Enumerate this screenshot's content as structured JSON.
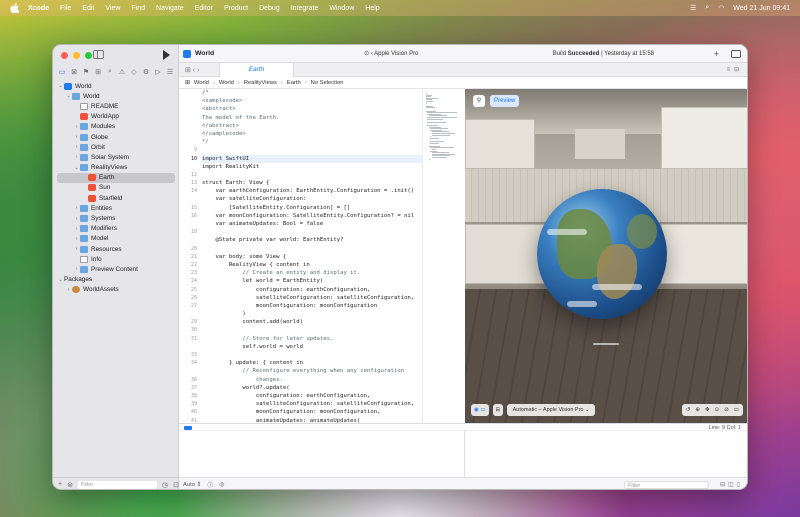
{
  "menubar": {
    "items": [
      "Xcode",
      "File",
      "Edit",
      "View",
      "Find",
      "Navigate",
      "Editor",
      "Product",
      "Debug",
      "Integrate",
      "Window",
      "Help"
    ],
    "clock": "Wed 21 Jun  09:41"
  },
  "window": {
    "project_name": "World",
    "scheme_device": "Apple Vision Pro",
    "build_prefix": "Build",
    "build_status": "Succeeded",
    "build_time": "| Yesterday at 15:58"
  },
  "tabbar": {
    "active_tab": "Earth"
  },
  "breadcrumbs": [
    "World",
    "World",
    "RealityViews",
    "Earth",
    "No Selection"
  ],
  "navigator": {
    "rows": [
      {
        "label": "World",
        "depth": 0,
        "icon": "proj",
        "chev": "⌄"
      },
      {
        "label": "World",
        "depth": 1,
        "icon": "folder",
        "chev": "⌄"
      },
      {
        "label": "README",
        "depth": 2,
        "icon": "doc",
        "chev": ""
      },
      {
        "label": "WorldApp",
        "depth": 2,
        "icon": "swift",
        "chev": ""
      },
      {
        "label": "Modules",
        "depth": 2,
        "icon": "folder",
        "chev": "›"
      },
      {
        "label": "Globe",
        "depth": 2,
        "icon": "folder",
        "chev": "›"
      },
      {
        "label": "Orbit",
        "depth": 2,
        "icon": "folder",
        "chev": "›"
      },
      {
        "label": "Solar System",
        "depth": 2,
        "icon": "folder",
        "chev": "›"
      },
      {
        "label": "RealityViews",
        "depth": 2,
        "icon": "folder",
        "chev": "⌄"
      },
      {
        "label": "Earth",
        "depth": 3,
        "icon": "swift",
        "chev": "",
        "selected": true
      },
      {
        "label": "Sun",
        "depth": 3,
        "icon": "swift",
        "chev": ""
      },
      {
        "label": "Starfield",
        "depth": 3,
        "icon": "swift",
        "chev": ""
      },
      {
        "label": "Entities",
        "depth": 2,
        "icon": "folder",
        "chev": "›"
      },
      {
        "label": "Systems",
        "depth": 2,
        "icon": "folder",
        "chev": "›"
      },
      {
        "label": "Modifiers",
        "depth": 2,
        "icon": "folder",
        "chev": "›"
      },
      {
        "label": "Model",
        "depth": 2,
        "icon": "folder",
        "chev": "›"
      },
      {
        "label": "Resources",
        "depth": 2,
        "icon": "folder",
        "chev": "›"
      },
      {
        "label": "Info",
        "depth": 2,
        "icon": "doc",
        "chev": ""
      },
      {
        "label": "Preview Content",
        "depth": 2,
        "icon": "folder",
        "chev": "›"
      },
      {
        "label": "Packages",
        "depth": 0,
        "icon": "none",
        "chev": "⌄"
      },
      {
        "label": "WorldAssets",
        "depth": 1,
        "icon": "pkg",
        "chev": "›"
      }
    ],
    "filter_placeholder": "Filter"
  },
  "code": {
    "line_numbers": [
      "",
      "",
      "",
      "",
      "",
      "",
      "",
      "9",
      "10",
      "",
      "12",
      "13",
      "14",
      "",
      "15",
      "16",
      "",
      "18",
      "",
      "20",
      "21",
      "22",
      "23",
      "24",
      "25",
      "26",
      "27",
      "",
      "29",
      "30",
      "31",
      "",
      "33",
      "34",
      "",
      "36",
      "37",
      "38",
      "39",
      "40",
      "41"
    ],
    "current_line_index": 8,
    "lines": [
      "/*",
      "<samplecode>",
      "<abstract>",
      "The model of the Earth.",
      "</abstract>",
      "</samplecode>",
      "*/",
      "",
      "import SwiftUI",
      "import RealityKit",
      "",
      "struct Earth: View {",
      "    var earthConfiguration: EarthEntity.Configuration = .init()",
      "    var satelliteConfiguration:",
      "        [SatelliteEntity.Configuration] = []",
      "    var moonConfiguration: SatelliteEntity.Configuration? = nil",
      "    var animateUpdates: Bool = false",
      "",
      "    @State private var world: EarthEntity?",
      "",
      "    var body: some View {",
      "        RealityView { content in",
      "            // Create an entity and display it.",
      "            let world = EarthEntity(",
      "                configuration: earthConfiguration,",
      "                satelliteConfiguration: satelliteConfiguration,",
      "                moonConfiguration: moonConfiguration",
      "            )",
      "            content.add(world)",
      "",
      "            // Store for later updates.",
      "            self.world = world",
      "",
      "        } update: { content in",
      "            // Reconfigure everything when any configuration",
      "                changes.",
      "            world?.update(",
      "                configuration: earthConfiguration,",
      "                satelliteConfiguration: satelliteConfiguration,",
      "                moonConfiguration: moonConfiguration,",
      "                animateUpdates: animateUpdates)",
      "        }"
    ]
  },
  "preview": {
    "pin_label": "⚲",
    "tag_label": "Preview",
    "device_selector": "Automatic – Apple Vision Pro"
  },
  "status": {
    "line_col": "Line: 9  Col: 1",
    "auto_label": "Auto ⇕",
    "console_filter": "Filter"
  }
}
